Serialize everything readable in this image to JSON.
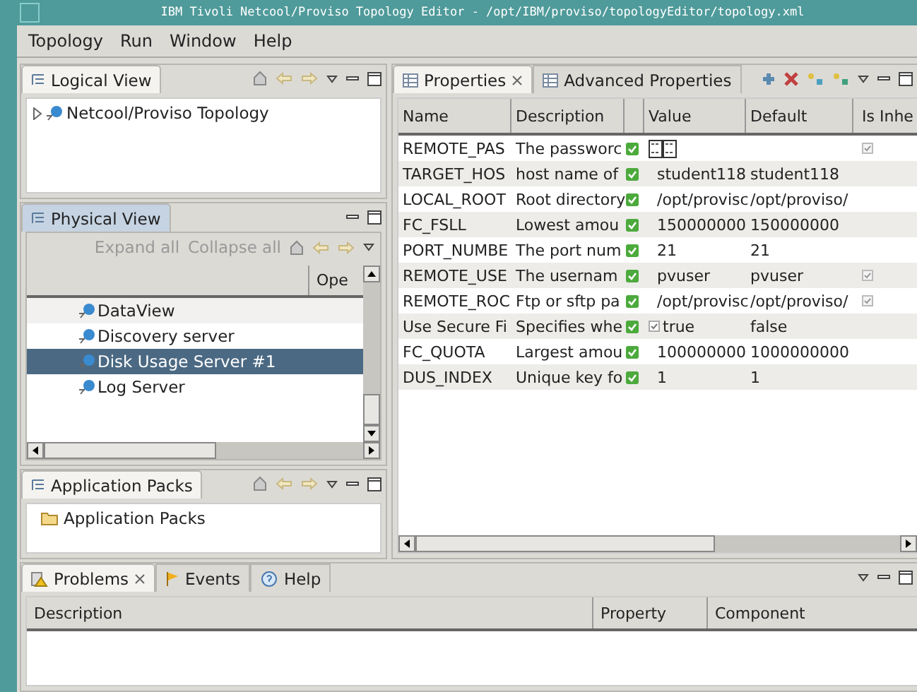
{
  "window": {
    "title": "IBM Tivoli Netcool/Proviso Topology Editor - /opt/IBM/proviso/topologyEditor/topology.xml"
  },
  "menu": [
    "Topology",
    "Run",
    "Window",
    "Help"
  ],
  "logical_view": {
    "tab": "Logical View",
    "tree": [
      {
        "label": "Netcool/Proviso Topology",
        "expanded": false
      }
    ]
  },
  "physical_view": {
    "tab": "Physical View",
    "actions": [
      "Expand all",
      "Collapse all"
    ],
    "columns": [
      "Ope"
    ],
    "items": [
      {
        "label": "DataView",
        "selected": false
      },
      {
        "label": "Discovery server",
        "selected": false
      },
      {
        "label": "Disk Usage Server #1",
        "selected": true
      },
      {
        "label": "Log Server",
        "selected": false
      }
    ]
  },
  "application_packs": {
    "tab": "Application Packs",
    "items": [
      "Application Packs"
    ]
  },
  "properties": {
    "tabs": [
      {
        "label": "Properties",
        "selected": true
      },
      {
        "label": "Advanced Properties",
        "selected": false
      }
    ],
    "columns": [
      "Name",
      "Description",
      "Value",
      "Default",
      "Is Inhe"
    ],
    "rows": [
      {
        "name": "REMOTE_PAS",
        "description": "The passworc",
        "required": true,
        "kind": "password",
        "inherited": true
      },
      {
        "name": "TARGET_HOS",
        "description": "host name of",
        "required": true,
        "kind": "text",
        "value": "student118",
        "default": "student118",
        "inherited": false
      },
      {
        "name": "LOCAL_ROOT",
        "description": "Root directory",
        "required": true,
        "kind": "text",
        "value": "/opt/provisc",
        "default": "/opt/proviso/",
        "inherited": false
      },
      {
        "name": "FC_FSLL",
        "description": "Lowest amou",
        "required": true,
        "kind": "text",
        "value": "150000000",
        "default": "150000000",
        "inherited": false
      },
      {
        "name": "PORT_NUMBE",
        "description": "The port num",
        "required": true,
        "kind": "text",
        "value": "21",
        "default": "21",
        "inherited": false
      },
      {
        "name": "REMOTE_USE",
        "description": "The usernam",
        "required": true,
        "kind": "text",
        "value": "pvuser",
        "default": "pvuser",
        "inherited": true
      },
      {
        "name": "REMOTE_ROC",
        "description": "Ftp or sftp pa",
        "required": true,
        "kind": "text",
        "value": "/opt/provisc",
        "default": "/opt/proviso/",
        "inherited": true
      },
      {
        "name": "Use Secure Fi",
        "description": "Specifies whe",
        "required": true,
        "kind": "boolean",
        "checked": true,
        "value": "true",
        "default": "false",
        "inherited": false
      },
      {
        "name": "FC_QUOTA",
        "description": "Largest amou",
        "required": true,
        "kind": "text",
        "value": "100000000",
        "default": "1000000000",
        "inherited": false
      },
      {
        "name": "DUS_INDEX",
        "description": "Unique key fo",
        "required": true,
        "kind": "text",
        "value": "1",
        "default": "1",
        "inherited": false
      }
    ]
  },
  "bottom": {
    "tabs": [
      {
        "label": "Problems",
        "selected": true
      },
      {
        "label": "Events",
        "selected": false
      },
      {
        "label": "Help",
        "selected": false
      }
    ],
    "columns": [
      "Description",
      "Property",
      "Component"
    ]
  }
}
